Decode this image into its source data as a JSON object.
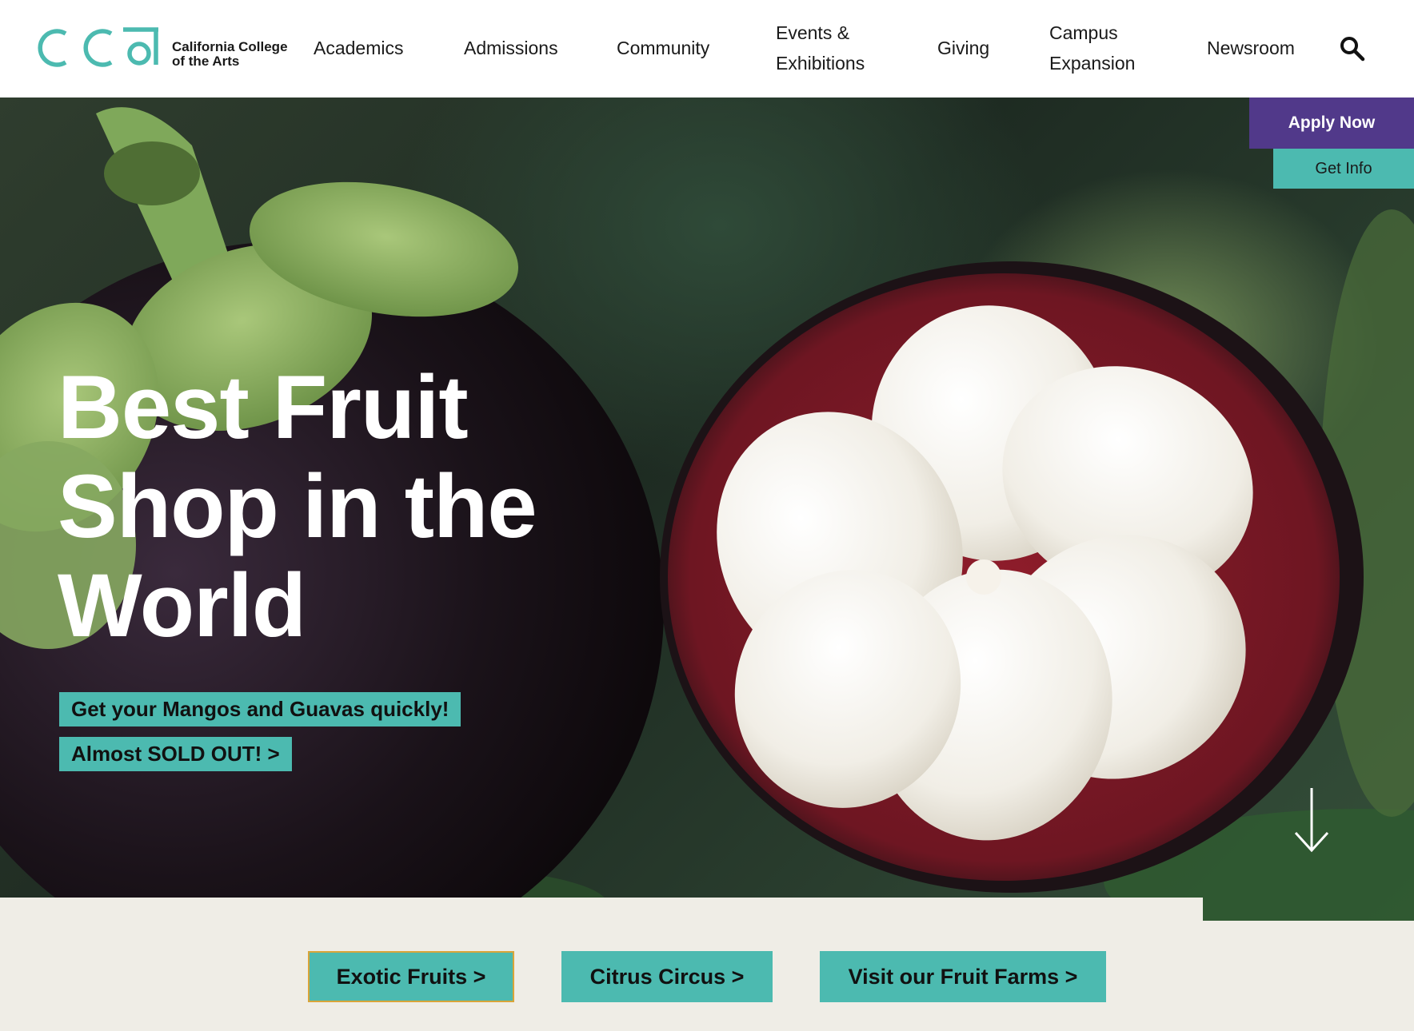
{
  "header": {
    "logo_line1": "California College",
    "logo_line2": "of the Arts",
    "nav": [
      {
        "line1": "Academics",
        "line2": ""
      },
      {
        "line1": "Admissions",
        "line2": ""
      },
      {
        "line1": "Community",
        "line2": ""
      },
      {
        "line1": "Events &",
        "line2": "Exhibitions"
      },
      {
        "line1": "Giving",
        "line2": ""
      },
      {
        "line1": "Campus",
        "line2": "Expansion"
      },
      {
        "line1": "Newsroom",
        "line2": ""
      }
    ],
    "search_icon": "search-icon"
  },
  "cta": {
    "apply": "Apply Now",
    "info": "Get Info"
  },
  "hero": {
    "title_line1": "Best Fruit",
    "title_line2": "Shop in the",
    "title_line3": "World",
    "tagline1": "Get your Mangos and Guavas quickly!",
    "tagline2": "Almost SOLD OUT! >",
    "scroll_icon": "arrow-down-icon"
  },
  "bottom": {
    "buttons": [
      "Exotic Fruits  >",
      "Citrus Circus  >",
      "Visit our Fruit Farms  >"
    ]
  },
  "colors": {
    "teal": "#4cbab0",
    "purple": "#51398a",
    "strip_bg": "#efede6"
  }
}
